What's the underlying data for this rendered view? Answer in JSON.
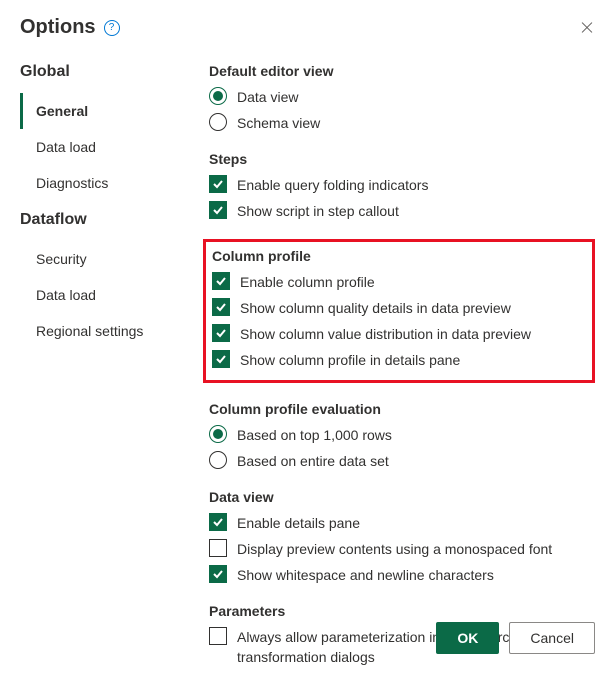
{
  "dialog": {
    "title": "Options",
    "close": "Close"
  },
  "sidebar": {
    "groups": [
      {
        "label": "Global",
        "items": [
          "General",
          "Data load",
          "Diagnostics"
        ],
        "selectedIndex": 0
      },
      {
        "label": "Dataflow",
        "items": [
          "Security",
          "Data load",
          "Regional settings"
        ],
        "selectedIndex": -1
      }
    ]
  },
  "sections": {
    "defaultEditorView": {
      "header": "Default editor view",
      "options": [
        {
          "label": "Data view",
          "checked": true
        },
        {
          "label": "Schema view",
          "checked": false
        }
      ]
    },
    "steps": {
      "header": "Steps",
      "options": [
        {
          "label": "Enable query folding indicators",
          "checked": true
        },
        {
          "label": "Show script in step callout",
          "checked": true
        }
      ]
    },
    "columnProfile": {
      "header": "Column profile",
      "options": [
        {
          "label": "Enable column profile",
          "checked": true
        },
        {
          "label": "Show column quality details in data preview",
          "checked": true
        },
        {
          "label": "Show column value distribution in data preview",
          "checked": true
        },
        {
          "label": "Show column profile in details pane",
          "checked": true
        }
      ]
    },
    "columnProfileEval": {
      "header": "Column profile evaluation",
      "options": [
        {
          "label": "Based on top 1,000 rows",
          "checked": true
        },
        {
          "label": "Based on entire data set",
          "checked": false
        }
      ]
    },
    "dataView": {
      "header": "Data view",
      "options": [
        {
          "label": "Enable details pane",
          "checked": true
        },
        {
          "label": "Display preview contents using a monospaced font",
          "checked": false
        },
        {
          "label": "Show whitespace and newline characters",
          "checked": true
        }
      ]
    },
    "parameters": {
      "header": "Parameters",
      "options": [
        {
          "label": "Always allow parameterization in data source and transformation dialogs",
          "checked": false
        }
      ]
    }
  },
  "footer": {
    "ok": "OK",
    "cancel": "Cancel"
  }
}
